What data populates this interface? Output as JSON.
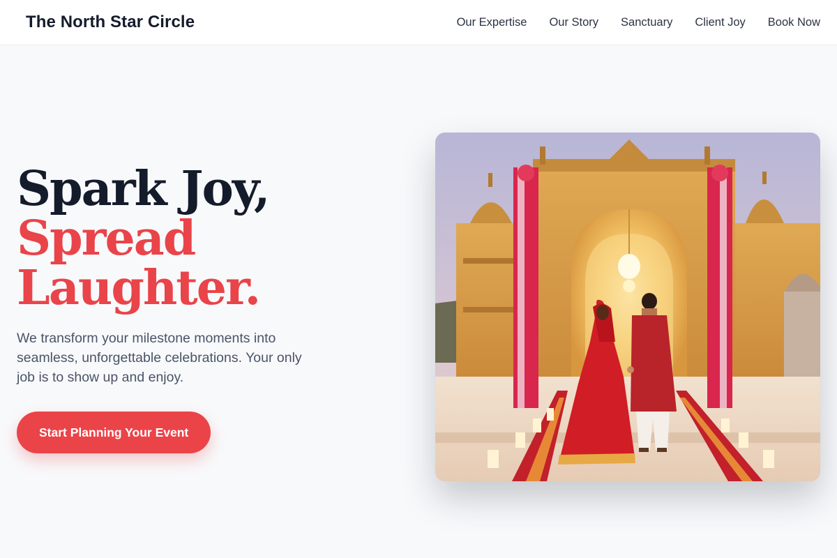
{
  "header": {
    "brand": "The North Star Circle",
    "nav": [
      {
        "label": "Our Expertise"
      },
      {
        "label": "Our Story"
      },
      {
        "label": "Sanctuary"
      },
      {
        "label": "Client Joy"
      },
      {
        "label": "Book Now"
      }
    ]
  },
  "hero": {
    "headline_line1": "Spark Joy,",
    "headline_line2": "Spread",
    "headline_line3": "Laughter.",
    "subtext": "We transform your milestone moments into seamless, unforgettable celebrations. Your only job is to show up and enjoy.",
    "cta_label": "Start Planning Your Event"
  },
  "colors": {
    "accent": "#ea4449",
    "heading": "#141b2b",
    "background": "#f8f9fb"
  }
}
